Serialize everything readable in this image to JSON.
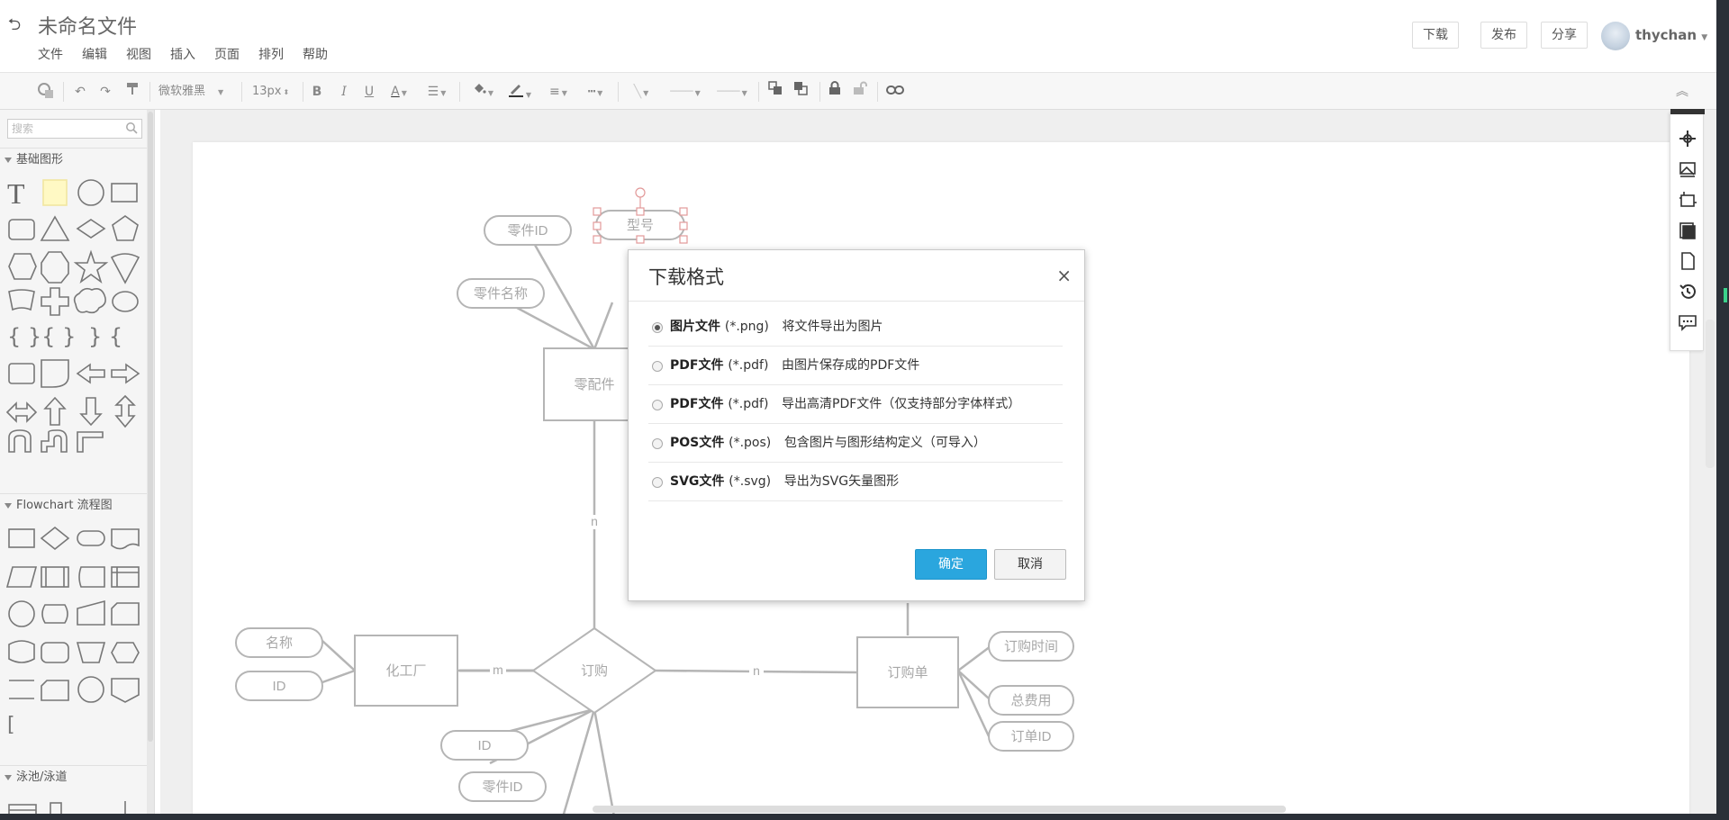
{
  "header": {
    "doc_title": "未命名文件",
    "menu": [
      "文件",
      "编辑",
      "视图",
      "插入",
      "页面",
      "排列",
      "帮助"
    ],
    "buttons": {
      "download": "下载",
      "publish": "发布",
      "share": "分享"
    },
    "username": "thychan"
  },
  "toolbar": {
    "font_family": "微软雅黑",
    "font_size": "13px",
    "bold": "B",
    "italic": "I",
    "underline": "U",
    "font_color": "A"
  },
  "left_panel": {
    "search_placeholder": "搜索",
    "categories": [
      "基础图形",
      "Flowchart 流程图",
      "泳池/泳道"
    ]
  },
  "diagram": {
    "entities": [
      "零配件",
      "化工厂",
      "订购单"
    ],
    "relationship": "订购",
    "attributes": [
      "型号",
      "零件ID",
      "零件名称",
      "名称",
      "ID",
      "订购时间",
      "总费用",
      "订单ID",
      "ID",
      "零件ID"
    ],
    "cardinalities": [
      "n",
      "m",
      "n"
    ]
  },
  "modal": {
    "title": "下载格式",
    "close": "×",
    "options": [
      {
        "name": "图片文件",
        "ext": "(*.png)",
        "desc": "将文件导出为图片",
        "selected": true
      },
      {
        "name": "PDF文件",
        "ext": "(*.pdf)",
        "desc": "由图片保存成的PDF文件",
        "selected": false
      },
      {
        "name": "PDF文件",
        "ext": "(*.pdf)",
        "desc": "导出高清PDF文件（仅支持部分字体样式）",
        "selected": false
      },
      {
        "name": "POS文件",
        "ext": "(*.pos)",
        "desc": "包含图片与图形结构定义（可导入）",
        "selected": false
      },
      {
        "name": "SVG文件",
        "ext": "(*.svg)",
        "desc": "导出为SVG矢量图形",
        "selected": false
      }
    ],
    "confirm": "确定",
    "cancel": "取消"
  },
  "colors": {
    "primary_button": "#2aa6de",
    "diagram_stroke": "#b5b5b5",
    "diagram_text": "#a8a8a8",
    "selection": "#e29999"
  }
}
